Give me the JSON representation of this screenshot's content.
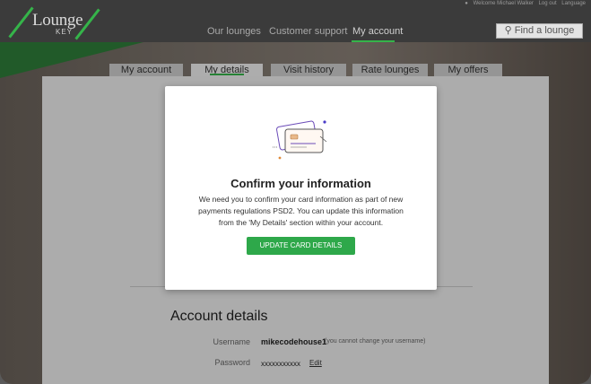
{
  "header": {
    "logo_main": "Lounge",
    "logo_sub": "KEY",
    "welcome": "Welcome Michael Walker",
    "top_links": [
      "Log out",
      "Language"
    ],
    "nav": [
      "Our lounges",
      "Customer support",
      "My account"
    ],
    "search_label": "Find a lounge"
  },
  "tabs": [
    "My account",
    "My details",
    "Visit history",
    "Rate lounges",
    "My offers"
  ],
  "modal": {
    "title": "Confirm your information",
    "body": "We need you to confirm your card information as part of new payments regulations PSD2. You can update this information from the 'My Details' section within your account.",
    "button": "UPDATE CARD DETAILS"
  },
  "account": {
    "title": "Account details",
    "username_label": "Username",
    "username_value": "mikecodehouse1",
    "username_note": "(you cannot change your username)",
    "password_label": "Password",
    "password_value": "xxxxxxxxxxx",
    "edit_label": "Edit"
  },
  "colors": {
    "accent": "#35b44a",
    "button": "#2ea84a",
    "header": "#3b3b3b"
  }
}
